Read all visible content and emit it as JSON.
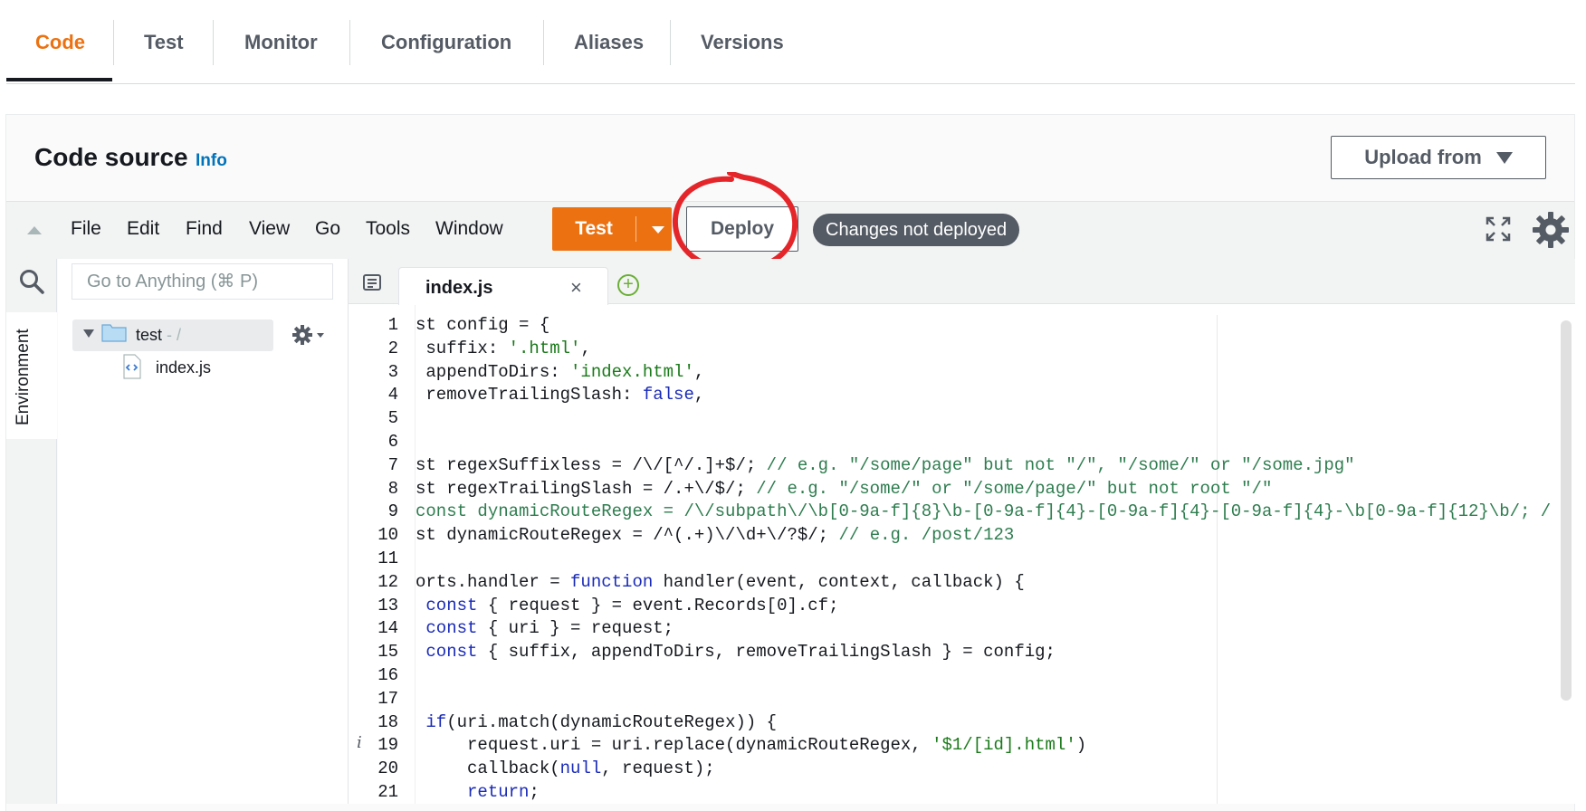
{
  "top_tabs": [
    {
      "label": "Code",
      "active": true
    },
    {
      "label": "Test",
      "active": false
    },
    {
      "label": "Monitor",
      "active": false
    },
    {
      "label": "Configuration",
      "active": false
    },
    {
      "label": "Aliases",
      "active": false
    },
    {
      "label": "Versions",
      "active": false
    }
  ],
  "code_source": {
    "title": "Code source",
    "info_link": "Info",
    "upload_label": "Upload from"
  },
  "ide": {
    "menu": [
      "File",
      "Edit",
      "Find",
      "View",
      "Go",
      "Tools",
      "Window"
    ],
    "test_label": "Test",
    "deploy_label": "Deploy",
    "status_badge": "Changes not deployed",
    "sidebar_tab": "Environment",
    "goto_placeholder": "Go to Anything (⌘ P)",
    "tree": {
      "folder_name": "test",
      "folder_path": " - /",
      "file_name": "index.js"
    },
    "open_tab": "index.js",
    "close_glyph": "×",
    "add_glyph": "+",
    "gutter_info_glyph": "i",
    "line_numbers": [
      "1",
      "2",
      "3",
      "4",
      "5",
      "6",
      "7",
      "8",
      "9",
      "10",
      "11",
      "12",
      "13",
      "14",
      "15",
      "16",
      "17",
      "18",
      "19",
      "20",
      "21"
    ],
    "code_lines": [
      "st config = {",
      " suffix: '.html',",
      " appendToDirs: 'index.html',",
      " removeTrailingSlash: false,",
      "",
      "",
      "st regexSuffixless = /\\/[^/.]+$/; // e.g. \"/some/page\" but not \"/\", \"/some/\" or \"/some.jpg\"",
      "st regexTrailingSlash = /.+\\/$/; // e.g. \"/some/\" or \"/some/page/\" but not root \"/\"",
      "const dynamicRouteRegex = /\\/subpath\\/\\b[0-9a-f]{8}\\b-[0-9a-f]{4}-[0-9a-f]{4}-[0-9a-f]{4}-\\b[0-9a-f]{12}\\b/; /",
      "st dynamicRouteRegex = /^(.+)\\/\\d+\\/?$/; // e.g. /post/123",
      "",
      "orts.handler = function handler(event, context, callback) {",
      " const { request } = event.Records[0].cf;",
      " const { uri } = request;",
      " const { suffix, appendToDirs, removeTrailingSlash } = config;",
      "",
      "",
      " if(uri.match(dynamicRouteRegex)) {",
      "     request.uri = uri.replace(dynamicRouteRegex, '$1/[id].html')",
      "     callback(null, request);",
      "     return;"
    ]
  },
  "colors": {
    "accent_orange": "#ec7211",
    "annotation_red": "#e4262a",
    "badge_gray": "#545b64",
    "link_blue": "#0073bb"
  },
  "icons": [
    "search-icon",
    "folder-icon",
    "file-icon",
    "gear-icon",
    "expand-icon",
    "document-icon",
    "close-icon",
    "add-icon",
    "caret-down-icon"
  ]
}
